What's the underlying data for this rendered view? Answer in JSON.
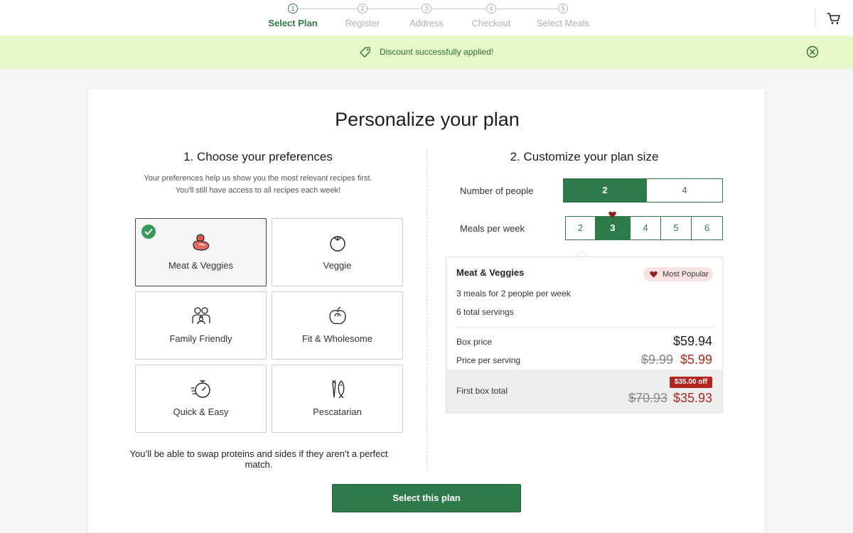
{
  "stepper": {
    "steps": [
      {
        "num": "1",
        "label": "Select Plan",
        "active": true
      },
      {
        "num": "2",
        "label": "Register",
        "active": false
      },
      {
        "num": "3",
        "label": "Address",
        "active": false
      },
      {
        "num": "4",
        "label": "Checkout",
        "active": false
      },
      {
        "num": "5",
        "label": "Select Meals",
        "active": false
      }
    ],
    "cart_icon": "cart-icon"
  },
  "banner": {
    "message": "Discount successfully applied!",
    "tag_icon": "tag-icon",
    "close_icon": "close-circle-icon",
    "background": "#e6f7c8"
  },
  "page": {
    "title": "Personalize your plan"
  },
  "preferences": {
    "heading": "1. Choose your preferences",
    "description": "Your preferences help us show you the most relevant recipes first. You'll still have access to all recipes each week!",
    "options": [
      {
        "label": "Meat & Veggies",
        "icon": "steak-tomato-icon",
        "selected": true
      },
      {
        "label": "Veggie",
        "icon": "tomato-icon",
        "selected": false
      },
      {
        "label": "Family Friendly",
        "icon": "family-icon",
        "selected": false
      },
      {
        "label": "Fit & Wholesome",
        "icon": "apple-scale-icon",
        "selected": false
      },
      {
        "label": "Quick & Easy",
        "icon": "stopwatch-icon",
        "selected": false
      },
      {
        "label": "Pescatarian",
        "icon": "fish-carrot-icon",
        "selected": false
      }
    ],
    "swap_note": "You’ll be able to swap proteins and sides if they aren’t a perfect match."
  },
  "plan_size": {
    "heading": "2. Customize your plan size",
    "people": {
      "label": "Number of people",
      "options": [
        "2",
        "4"
      ],
      "selected": "2"
    },
    "meals": {
      "label": "Meals per week",
      "options": [
        "2",
        "3",
        "4",
        "5",
        "6"
      ],
      "selected": "3"
    }
  },
  "summary": {
    "plan_name": "Meat & Veggies",
    "badge": "Most Popular",
    "line1": "3 meals for 2 people per week",
    "line2": "6 total servings",
    "box_price_label": "Box price",
    "box_price": "$59.94",
    "per_serving_label": "Price per serving",
    "per_serving_old": "$9.99",
    "per_serving_new": "$5.99",
    "first_box_label": "First box total",
    "discount_badge": "$35.00 off",
    "first_box_old": "$70.93",
    "first_box_new": "$35.93"
  },
  "cta": {
    "label": "Select this plan"
  },
  "colors": {
    "brand_green": "#2f7a4b",
    "discount_red": "#b3261e",
    "badge_pink": "#fbe3e3"
  }
}
